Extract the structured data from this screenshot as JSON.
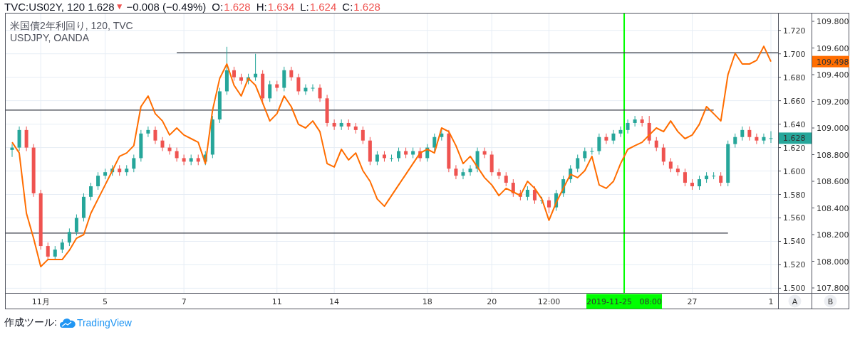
{
  "header": {
    "symbol": "TVC:US02Y, 120",
    "last": "1.628",
    "arrow": "▼",
    "change": "−0.008 (−0.49%)",
    "ohlc": [
      {
        "label": "O:",
        "value": "1.628"
      },
      {
        "label": "H:",
        "value": "1.634"
      },
      {
        "label": "L:",
        "value": "1.624"
      },
      {
        "label": "C:",
        "value": "1.628"
      }
    ]
  },
  "chart": {
    "axis_buttons": [
      "A",
      "B"
    ],
    "badges": [
      {
        "text": "1.628",
        "color": "#26a69a"
      },
      {
        "text": "109.498",
        "color": "#ff6d00"
      }
    ],
    "chart_data": {
      "type": "candlestick",
      "title": "米国債2年利回り, 120, TVC",
      "grid": true,
      "ylim": [
        1.496,
        1.735
      ],
      "categories": [
        null,
        null,
        null,
        null,
        "11月",
        null,
        null,
        null,
        null,
        null,
        null,
        null,
        null,
        "5",
        null,
        null,
        null,
        null,
        null,
        null,
        null,
        null,
        null,
        null,
        "7",
        null,
        null,
        null,
        null,
        null,
        null,
        null,
        null,
        null,
        null,
        null,
        null,
        "11",
        null,
        null,
        null,
        null,
        null,
        null,
        null,
        "14",
        null,
        null,
        null,
        null,
        null,
        null,
        null,
        null,
        null,
        null,
        null,
        null,
        "18",
        null,
        null,
        null,
        null,
        null,
        null,
        null,
        null,
        "20",
        null,
        null,
        null,
        null,
        null,
        null,
        null,
        "12:00",
        null,
        null,
        null,
        null,
        null,
        null,
        null,
        null,
        null,
        null,
        null,
        null,
        null,
        null,
        null,
        null,
        null,
        null,
        null,
        "27",
        null,
        null,
        null,
        null,
        null,
        null,
        null,
        null,
        null,
        null,
        "1"
      ],
      "yticks": [
        {
          "value": 1.5,
          "label": "1.500"
        },
        {
          "value": 1.52,
          "label": "1.520"
        },
        {
          "value": 1.54,
          "label": "1.540"
        },
        {
          "value": 1.56,
          "label": "1.560"
        },
        {
          "value": 1.58,
          "label": "1.580"
        },
        {
          "value": 1.6,
          "label": "1.600"
        },
        {
          "value": 1.62,
          "label": "1.620"
        },
        {
          "value": 1.64,
          "label": "1.640"
        },
        {
          "value": 1.66,
          "label": "1.660"
        },
        {
          "value": 1.68,
          "label": "1.680"
        },
        {
          "value": 1.7,
          "label": "1.700"
        },
        {
          "value": 1.72,
          "label": "1.720"
        }
      ],
      "ohlc": [
        [
          1.618,
          1.623,
          1.612,
          1.62
        ],
        [
          1.62,
          1.638,
          1.617,
          1.635
        ],
        [
          1.635,
          1.638,
          1.617,
          1.62
        ],
        [
          1.62,
          1.623,
          1.578,
          1.581
        ],
        [
          1.581,
          1.584,
          1.533,
          1.536
        ],
        [
          1.536,
          1.539,
          1.524,
          1.527
        ],
        [
          1.527,
          1.536,
          1.524,
          1.533
        ],
        [
          1.533,
          1.542,
          1.53,
          1.539
        ],
        [
          1.539,
          1.551,
          1.536,
          1.548
        ],
        [
          1.548,
          1.563,
          1.545,
          1.56
        ],
        [
          1.56,
          1.581,
          1.557,
          1.578
        ],
        [
          1.578,
          1.59,
          1.575,
          1.587
        ],
        [
          1.587,
          1.599,
          1.584,
          1.596
        ],
        [
          1.596,
          1.602,
          1.593,
          1.599
        ],
        [
          1.599,
          1.605,
          1.596,
          1.602
        ],
        [
          1.602,
          1.605,
          1.596,
          1.599
        ],
        [
          1.599,
          1.605,
          1.596,
          1.602
        ],
        [
          1.602,
          1.614,
          1.599,
          1.611
        ],
        [
          1.611,
          1.635,
          1.608,
          1.632
        ],
        [
          1.632,
          1.638,
          1.629,
          1.635
        ],
        [
          1.635,
          1.638,
          1.623,
          1.626
        ],
        [
          1.626,
          1.629,
          1.617,
          1.62
        ],
        [
          1.62,
          1.623,
          1.614,
          1.617
        ],
        [
          1.617,
          1.62,
          1.608,
          1.611
        ],
        [
          1.611,
          1.614,
          1.605,
          1.608
        ],
        [
          1.608,
          1.614,
          1.605,
          1.611
        ],
        [
          1.611,
          1.614,
          1.605,
          1.608
        ],
        [
          1.608,
          1.617,
          1.605,
          1.614
        ],
        [
          1.614,
          1.647,
          1.611,
          1.644
        ],
        [
          1.644,
          1.671,
          1.641,
          1.668
        ],
        [
          1.668,
          1.706,
          1.665,
          1.686
        ],
        [
          1.686,
          1.689,
          1.677,
          1.68
        ],
        [
          1.68,
          1.683,
          1.674,
          1.677
        ],
        [
          1.677,
          1.683,
          1.674,
          1.68
        ],
        [
          1.68,
          1.7,
          1.677,
          1.683
        ],
        [
          1.683,
          1.686,
          1.659,
          1.662
        ],
        [
          1.662,
          1.677,
          1.659,
          1.674
        ],
        [
          1.674,
          1.677,
          1.668,
          1.671
        ],
        [
          1.671,
          1.689,
          1.668,
          1.686
        ],
        [
          1.686,
          1.689,
          1.677,
          1.68
        ],
        [
          1.68,
          1.683,
          1.665,
          1.668
        ],
        [
          1.668,
          1.674,
          1.665,
          1.671
        ],
        [
          1.671,
          1.674,
          1.668,
          1.671
        ],
        [
          1.671,
          1.674,
          1.659,
          1.662
        ],
        [
          1.662,
          1.665,
          1.638,
          1.641
        ],
        [
          1.641,
          1.644,
          1.635,
          1.638
        ],
        [
          1.638,
          1.644,
          1.635,
          1.641
        ],
        [
          1.641,
          1.644,
          1.635,
          1.638
        ],
        [
          1.638,
          1.641,
          1.632,
          1.635
        ],
        [
          1.635,
          1.638,
          1.623,
          1.626
        ],
        [
          1.626,
          1.629,
          1.605,
          1.608
        ],
        [
          1.608,
          1.617,
          1.605,
          1.614
        ],
        [
          1.614,
          1.617,
          1.608,
          1.611
        ],
        [
          1.611,
          1.614,
          1.608,
          1.611
        ],
        [
          1.611,
          1.62,
          1.608,
          1.617
        ],
        [
          1.617,
          1.62,
          1.611,
          1.614
        ],
        [
          1.614,
          1.62,
          1.611,
          1.617
        ],
        [
          1.617,
          1.62,
          1.608,
          1.611
        ],
        [
          1.611,
          1.623,
          1.608,
          1.62
        ],
        [
          1.62,
          1.632,
          1.617,
          1.629
        ],
        [
          1.629,
          1.635,
          1.626,
          1.632
        ],
        [
          1.632,
          1.635,
          1.599,
          1.602
        ],
        [
          1.602,
          1.605,
          1.593,
          1.596
        ],
        [
          1.596,
          1.602,
          1.593,
          1.599
        ],
        [
          1.599,
          1.605,
          1.596,
          1.602
        ],
        [
          1.602,
          1.62,
          1.599,
          1.617
        ],
        [
          1.617,
          1.62,
          1.611,
          1.614
        ],
        [
          1.614,
          1.617,
          1.596,
          1.599
        ],
        [
          1.599,
          1.602,
          1.593,
          1.596
        ],
        [
          1.596,
          1.599,
          1.587,
          1.59
        ],
        [
          1.59,
          1.593,
          1.578,
          1.581
        ],
        [
          1.581,
          1.584,
          1.575,
          1.578
        ],
        [
          1.578,
          1.587,
          1.575,
          1.584
        ],
        [
          1.584,
          1.587,
          1.572,
          1.575
        ],
        [
          1.575,
          1.578,
          1.572,
          1.575
        ],
        [
          1.575,
          1.578,
          1.564,
          1.569
        ],
        [
          1.569,
          1.584,
          1.566,
          1.581
        ],
        [
          1.581,
          1.596,
          1.578,
          1.593
        ],
        [
          1.593,
          1.605,
          1.59,
          1.602
        ],
        [
          1.602,
          1.614,
          1.599,
          1.611
        ],
        [
          1.611,
          1.62,
          1.608,
          1.617
        ],
        [
          1.617,
          1.62,
          1.614,
          1.617
        ],
        [
          1.617,
          1.632,
          1.614,
          1.629
        ],
        [
          1.629,
          1.632,
          1.623,
          1.626
        ],
        [
          1.626,
          1.635,
          1.623,
          1.632
        ],
        [
          1.632,
          1.638,
          1.629,
          1.635
        ],
        [
          1.635,
          1.644,
          1.632,
          1.641
        ],
        [
          1.641,
          1.647,
          1.638,
          1.644
        ],
        [
          1.644,
          1.647,
          1.638,
          1.641
        ],
        [
          1.641,
          1.647,
          1.623,
          1.626
        ],
        [
          1.626,
          1.629,
          1.617,
          1.62
        ],
        [
          1.62,
          1.623,
          1.605,
          1.608
        ],
        [
          1.608,
          1.611,
          1.599,
          1.602
        ],
        [
          1.602,
          1.605,
          1.596,
          1.599
        ],
        [
          1.599,
          1.602,
          1.587,
          1.59
        ],
        [
          1.59,
          1.593,
          1.584,
          1.587
        ],
        [
          1.587,
          1.596,
          1.584,
          1.593
        ],
        [
          1.593,
          1.599,
          1.59,
          1.596
        ],
        [
          1.596,
          1.599,
          1.593,
          1.596
        ],
        [
          1.596,
          1.599,
          1.587,
          1.59
        ],
        [
          1.59,
          1.626,
          1.587,
          1.623
        ],
        [
          1.623,
          1.632,
          1.62,
          1.629
        ],
        [
          1.629,
          1.638,
          1.626,
          1.635
        ],
        [
          1.635,
          1.638,
          1.626,
          1.629
        ],
        [
          1.629,
          1.632,
          1.623,
          1.626
        ],
        [
          1.626,
          1.632,
          1.623,
          1.629
        ],
        [
          1.628,
          1.634,
          1.624,
          1.628
        ]
      ],
      "ref_lines": [
        {
          "axis": "y",
          "value": 1.701
        },
        {
          "axis": "y",
          "value": 1.652
        },
        {
          "axis": "y",
          "value": 1.547
        }
      ],
      "annotations": [
        "2019-11-25   08:00"
      ]
    },
    "overlay": {
      "chart_data": {
        "type": "line",
        "ylim": [
          107.64,
          109.864
        ],
        "yticks": [
          {
            "value": 107.8,
            "label": "107.800"
          },
          {
            "value": 108,
            "label": "108.000"
          },
          {
            "value": 108.2,
            "label": "108.200"
          },
          {
            "value": 108.4,
            "label": "108.400"
          },
          {
            "value": 108.6,
            "label": "108.600"
          },
          {
            "value": 108.8,
            "label": "108.800"
          },
          {
            "value": 109,
            "label": "109.000"
          },
          {
            "value": 109.2,
            "label": "109.200"
          },
          {
            "value": 109.4,
            "label": "109.400"
          },
          {
            "value": 109.6,
            "label": "109.600"
          },
          {
            "value": 109.8,
            "label": "109.800"
          }
        ],
        "series": [
          {
            "name": "USDJPY, OANDA",
            "color": "#ff6d00",
            "values": [
              108.893,
              108.813,
              108.36,
              108.173,
              107.96,
              108.013,
              108.013,
              108.013,
              108.083,
              108.173,
              108.2,
              108.36,
              108.467,
              108.573,
              108.68,
              108.787,
              108.813,
              108.867,
              109.16,
              109.24,
              109.107,
              109.053,
              108.947,
              109.0,
              108.947,
              108.92,
              108.893,
              108.733,
              109.133,
              109.373,
              109.48,
              109.32,
              109.24,
              109.373,
              109.32,
              109.187,
              109.053,
              109.107,
              109.24,
              109.16,
              109.027,
              109.0,
              109.053,
              108.973,
              108.733,
              108.707,
              108.84,
              108.76,
              108.813,
              108.68,
              108.6,
              108.467,
              108.413,
              108.493,
              108.573,
              108.653,
              108.733,
              108.813,
              108.84,
              108.813,
              109.0,
              108.973,
              108.867,
              108.733,
              108.787,
              108.707,
              108.627,
              108.573,
              108.493,
              108.547,
              108.52,
              108.493,
              108.6,
              108.547,
              108.467,
              108.307,
              108.44,
              108.547,
              108.653,
              108.627,
              108.68,
              108.787,
              108.573,
              108.547,
              108.6,
              108.733,
              108.84,
              108.867,
              108.893,
              108.947,
              109.0,
              108.973,
              109.053,
              108.973,
              108.92,
              108.947,
              109.027,
              109.16,
              109.107,
              109.053,
              109.4,
              109.56,
              109.48,
              109.48,
              109.507,
              109.613,
              109.498
            ]
          }
        ]
      }
    }
  },
  "footer": {
    "prefix": "作成ツール:",
    "brand": "TradingView"
  }
}
